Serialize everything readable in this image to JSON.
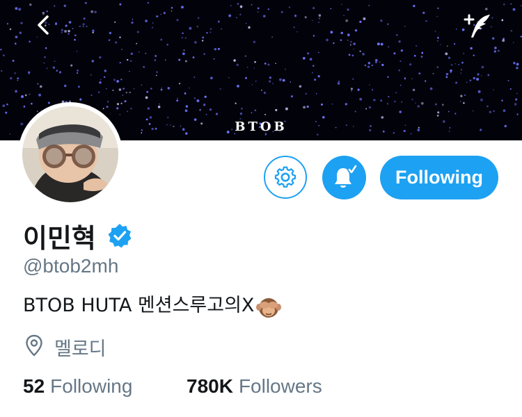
{
  "colors": {
    "accent": "#1da1f2",
    "text_primary": "#14171a",
    "text_secondary": "#657786",
    "banner_background": "#02020a",
    "banner_lights": "#6d74ff"
  },
  "header": {
    "back_icon": "chevron-left-icon",
    "compose_icon": "compose-tweet-icon",
    "banner_text": "BTOB"
  },
  "profile": {
    "display_name": "이민혁",
    "verified": true,
    "handle": "@btob2mh",
    "bio": "BTOB HUTA 멘션스루고의X",
    "bio_emoji": "see-no-evil-monkey-emoji",
    "location": "멜로디"
  },
  "actions": {
    "settings_icon": "gear-icon",
    "notifications_icon": "bell-check-icon",
    "follow_label": "Following"
  },
  "stats": {
    "following_count": "52",
    "following_label": "Following",
    "followers_count": "780K",
    "followers_label": "Followers"
  }
}
